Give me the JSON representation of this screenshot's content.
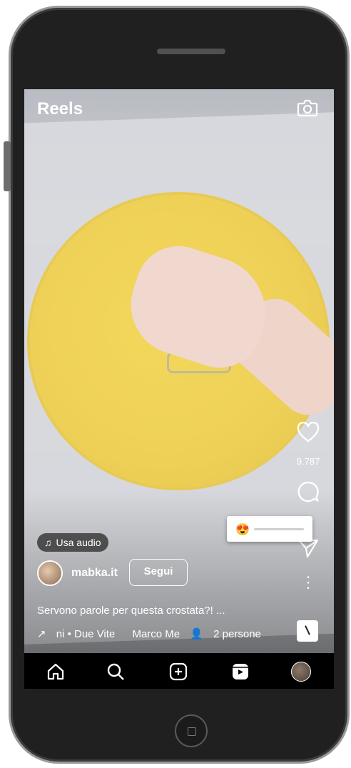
{
  "header": {
    "title": "Reels",
    "camera_icon": "camera-icon"
  },
  "actions": {
    "like_icon": "heart-icon",
    "like_count": "9.787",
    "comment_icon": "comment-icon",
    "share_icon": "send-icon",
    "more_icon": "more-icon",
    "more_glyph": "⋮"
  },
  "emoji_slider": {
    "emoji": "😍",
    "value": 0
  },
  "audio_button": {
    "label": "Usa audio",
    "icon": "music-note-icon"
  },
  "post": {
    "username": "mabka.it",
    "follow_label": "Segui",
    "caption": "Servono parole per questa crostata?! ...",
    "audio_track": "ni • Due Vite",
    "collaborator": "Marco Me",
    "people": "2 persone"
  },
  "tabbar": [
    "home-icon",
    "search-icon",
    "create-icon",
    "reels-icon",
    "profile-avatar"
  ]
}
